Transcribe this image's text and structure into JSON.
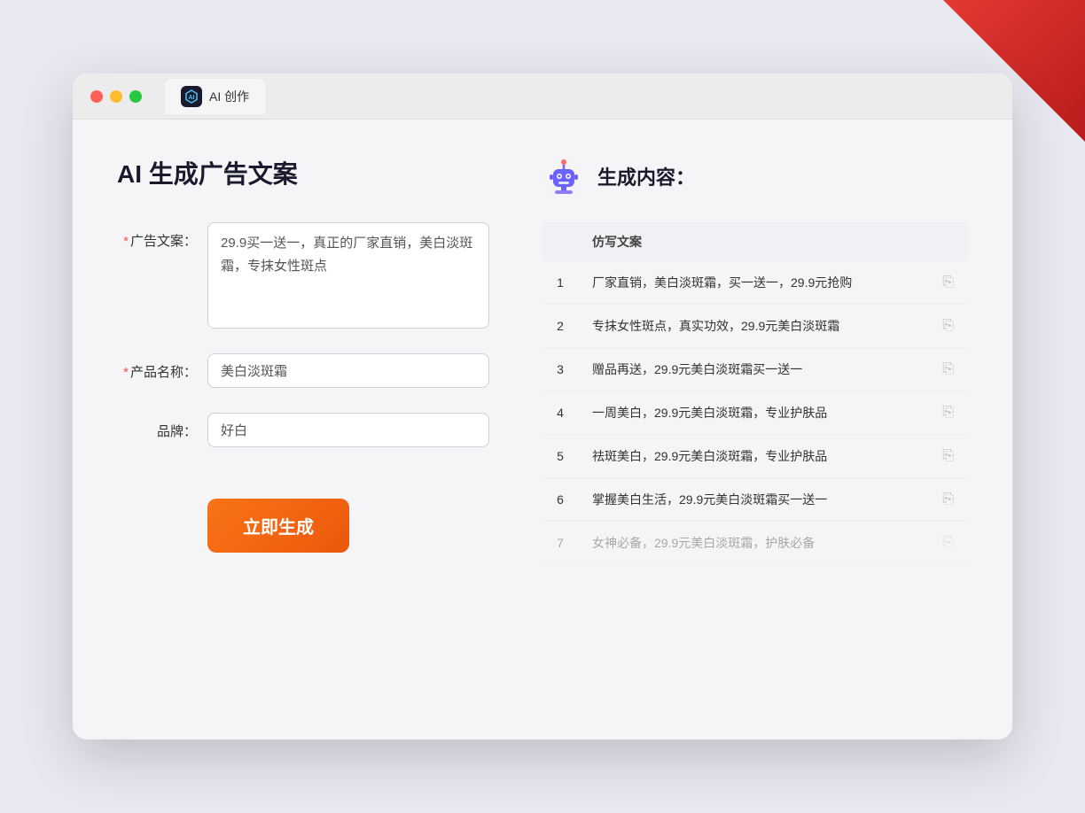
{
  "window": {
    "title": "AI 创作",
    "tab_label": "AI 创作"
  },
  "left_panel": {
    "title": "AI 生成广告文案",
    "form": {
      "ad_copy_label": "广告文案：",
      "ad_copy_required": true,
      "ad_copy_value": "29.9买一送一，真正的厂家直销，美白淡斑霜，专抹女性斑点",
      "product_name_label": "产品名称：",
      "product_name_required": true,
      "product_name_value": "美白淡斑霜",
      "brand_label": "品牌：",
      "brand_required": false,
      "brand_value": "好白"
    },
    "generate_button": "立即生成"
  },
  "right_panel": {
    "title": "生成内容：",
    "column_header": "仿写文案",
    "results": [
      {
        "id": 1,
        "text": "厂家直销，美白淡斑霜，买一送一，29.9元抢购"
      },
      {
        "id": 2,
        "text": "专抹女性斑点，真实功效，29.9元美白淡斑霜"
      },
      {
        "id": 3,
        "text": "赠品再送，29.9元美白淡斑霜买一送一"
      },
      {
        "id": 4,
        "text": "一周美白，29.9元美白淡斑霜，专业护肤品"
      },
      {
        "id": 5,
        "text": "祛斑美白，29.9元美白淡斑霜，专业护肤品"
      },
      {
        "id": 6,
        "text": "掌握美白生活，29.9元美白淡斑霜买一送一"
      },
      {
        "id": 7,
        "text": "女神必备，29.9元美白淡斑霜，护肤必备"
      }
    ]
  }
}
